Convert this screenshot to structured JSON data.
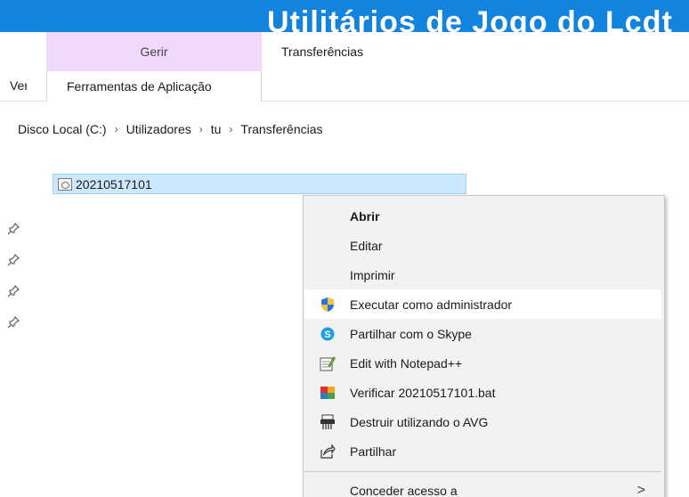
{
  "titlebar": {
    "title": "Utilitários de Jogo do Lcdt"
  },
  "ribbon": {
    "tab_gerir": "Gerir",
    "tab_transferencias": "Transferências",
    "tab_ver": "Ver",
    "tab_ferramentas": "Ferramentas de Aplicação"
  },
  "breadcrumb": {
    "items": [
      "Disco Local (C:)",
      "Utilizadores",
      "tu",
      "Transferências"
    ],
    "separator": "›"
  },
  "file": {
    "name": "20210517101"
  },
  "context_menu": {
    "items": [
      {
        "label": "Abrir",
        "icon": "none",
        "bold": true
      },
      {
        "label": "Editar",
        "icon": "none"
      },
      {
        "label": "Imprimir",
        "icon": "none"
      },
      {
        "label": "Executar como administrador",
        "icon": "uac-shield-icon"
      },
      {
        "label": "Partilhar com o Skype",
        "icon": "skype-icon"
      },
      {
        "label": "Edit with Notepad++",
        "icon": "notepad-plus-plus-icon"
      },
      {
        "label": "Verificar 20210517101.bat",
        "icon": "avg-icon"
      },
      {
        "label": "Destruir utilizando o AVG",
        "icon": "shredder-icon"
      },
      {
        "label": "Partilhar",
        "icon": "share-icon"
      },
      {
        "label": "Conceder acesso a",
        "icon": "none",
        "submenu": true
      }
    ],
    "submenu_chevron": ">"
  },
  "colors": {
    "titlebar": "#1284dd",
    "tab_gerir_bg": "#f0d9fb",
    "selection_bg": "#cce8ff",
    "menu_bg": "#f2f2f2"
  }
}
